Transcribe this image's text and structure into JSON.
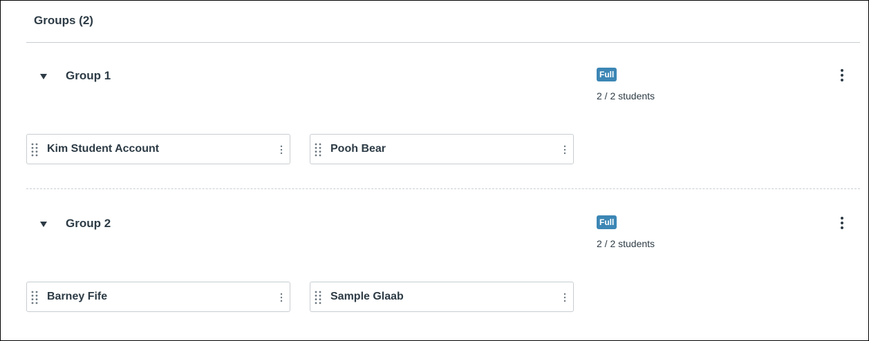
{
  "groups_panel": {
    "heading": "Groups (2)",
    "groups": [
      {
        "name": "Group 1",
        "status": "Full",
        "count": "2 / 2 students",
        "members": [
          "Kim Student Account",
          "Pooh Bear"
        ]
      },
      {
        "name": "Group 2",
        "status": "Full",
        "count": "2 / 2 students",
        "members": [
          "Barney Fife",
          "Sample Glaab"
        ]
      }
    ]
  },
  "colors": {
    "badge": "#3c86b5",
    "text": "#2d3b45",
    "border": "#c7cdd1"
  },
  "icons": {
    "toggle": "caret-down-icon",
    "group_menu": "vertical-ellipsis-icon",
    "drag": "drag-handle-icon",
    "member_menu": "vertical-ellipsis-icon"
  }
}
